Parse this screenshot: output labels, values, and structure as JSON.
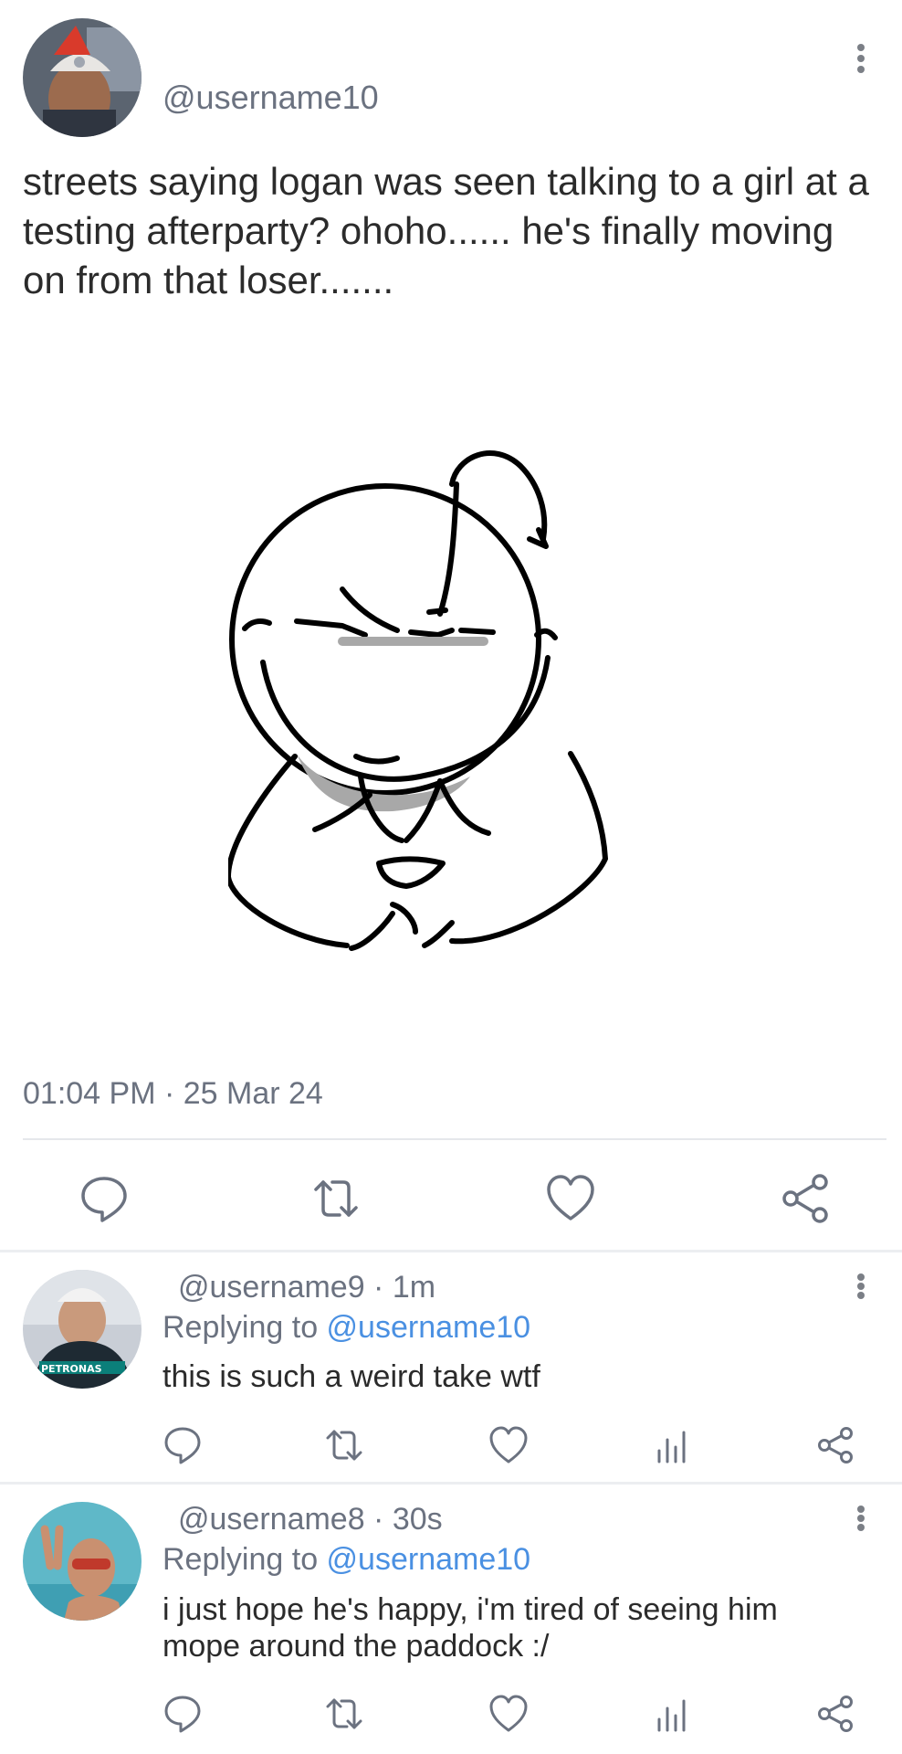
{
  "main_tweet": {
    "handle": "@username10",
    "text": "streets saying logan was seen talking to a girl at a testing afterparty? ohoho...... he's finally moving on from that loser.......",
    "timestamp": "01:04 PM · 25 Mar 24",
    "actions": [
      "reply-icon",
      "retweet-icon",
      "like-icon",
      "share-icon"
    ]
  },
  "replies": [
    {
      "handle_line": "@username9 · 1m",
      "replying_prefix": "Replying to ",
      "replying_to": "@username10",
      "text": "this is such a weird take wtf",
      "avatar_badge": "PETRONAS"
    },
    {
      "handle_line": "@username8 · 30s",
      "replying_prefix": "Replying to ",
      "replying_to": "@username10",
      "text": "i just hope he's happy, i'm tired of seeing him mope around the paddock :/"
    }
  ],
  "colors": {
    "link": "#4a90e2",
    "muted": "#6b7280",
    "icon": "#7b7f86",
    "divider": "#e5e7eb"
  }
}
